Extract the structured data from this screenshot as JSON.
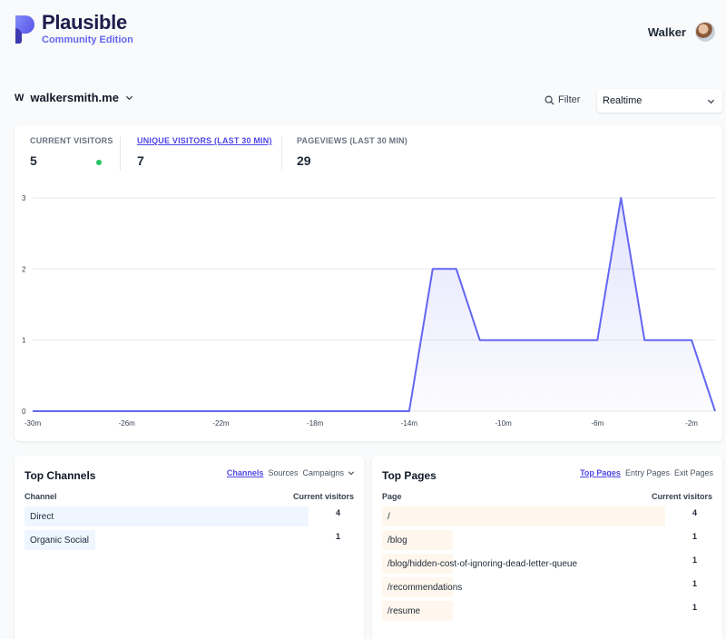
{
  "header": {
    "brand": "Plausible",
    "edition": "Community Edition",
    "user_name": "Walker"
  },
  "site": {
    "favicon": "W",
    "domain": "walkersmith.me",
    "filter_label": "Filter",
    "period": "Realtime"
  },
  "stats": [
    {
      "label": "CURRENT VISITORS",
      "value": "5",
      "active": false
    },
    {
      "label": "UNIQUE VISITORS (LAST 30 MIN)",
      "value": "7",
      "active": true
    },
    {
      "label": "PAGEVIEWS (LAST 30 MIN)",
      "value": "29",
      "active": false
    }
  ],
  "chart_data": {
    "type": "area",
    "x": [
      -30,
      -29,
      -28,
      -27,
      -26,
      -25,
      -24,
      -23,
      -22,
      -21,
      -20,
      -19,
      -18,
      -17,
      -16,
      -15,
      -14,
      -13,
      -12,
      -11,
      -10,
      -9,
      -8,
      -7,
      -6,
      -5,
      -4,
      -3,
      -2,
      -1,
      0
    ],
    "values": [
      0,
      0,
      0,
      0,
      0,
      0,
      0,
      0,
      0,
      0,
      0,
      0,
      0,
      0,
      0,
      0,
      0,
      2,
      2,
      1,
      1,
      1,
      1,
      1,
      1,
      3,
      1,
      1,
      1,
      0,
      0
    ],
    "x_ticks": [
      "-30m",
      "-26m",
      "-22m",
      "-18m",
      "-14m",
      "-10m",
      "-6m",
      "-2m"
    ],
    "x_tick_values": [
      -30,
      -26,
      -22,
      -18,
      -14,
      -10,
      -6,
      -2
    ],
    "y_ticks": [
      "0",
      "1",
      "2",
      "3"
    ],
    "ylim": [
      0,
      3
    ],
    "xlim": [
      -30,
      -1
    ],
    "grid": true,
    "line_color": "#6366f1"
  },
  "channels": {
    "title": "Top Channels",
    "tabs": [
      "Channels",
      "Sources",
      "Campaigns"
    ],
    "col_label": "Channel",
    "col_value": "Current visitors",
    "rows": [
      {
        "label": "Direct",
        "value": "4",
        "fraction": 1.0
      },
      {
        "label": "Organic Social",
        "value": "1",
        "fraction": 0.25
      }
    ],
    "bar_color": "#eff6ff"
  },
  "pages": {
    "title": "Top Pages",
    "tabs": [
      "Top Pages",
      "Entry Pages",
      "Exit Pages"
    ],
    "col_label": "Page",
    "col_value": "Current visitors",
    "rows": [
      {
        "label": "/",
        "value": "4",
        "fraction": 1.0
      },
      {
        "label": "/blog",
        "value": "1",
        "fraction": 0.25
      },
      {
        "label": "/blog/hidden-cost-of-ignoring-dead-letter-queue",
        "value": "1",
        "fraction": 0.25
      },
      {
        "label": "/recommendations",
        "value": "1",
        "fraction": 0.25
      },
      {
        "label": "/resume",
        "value": "1",
        "fraction": 0.25
      }
    ],
    "bar_color": "#fff7ed"
  }
}
